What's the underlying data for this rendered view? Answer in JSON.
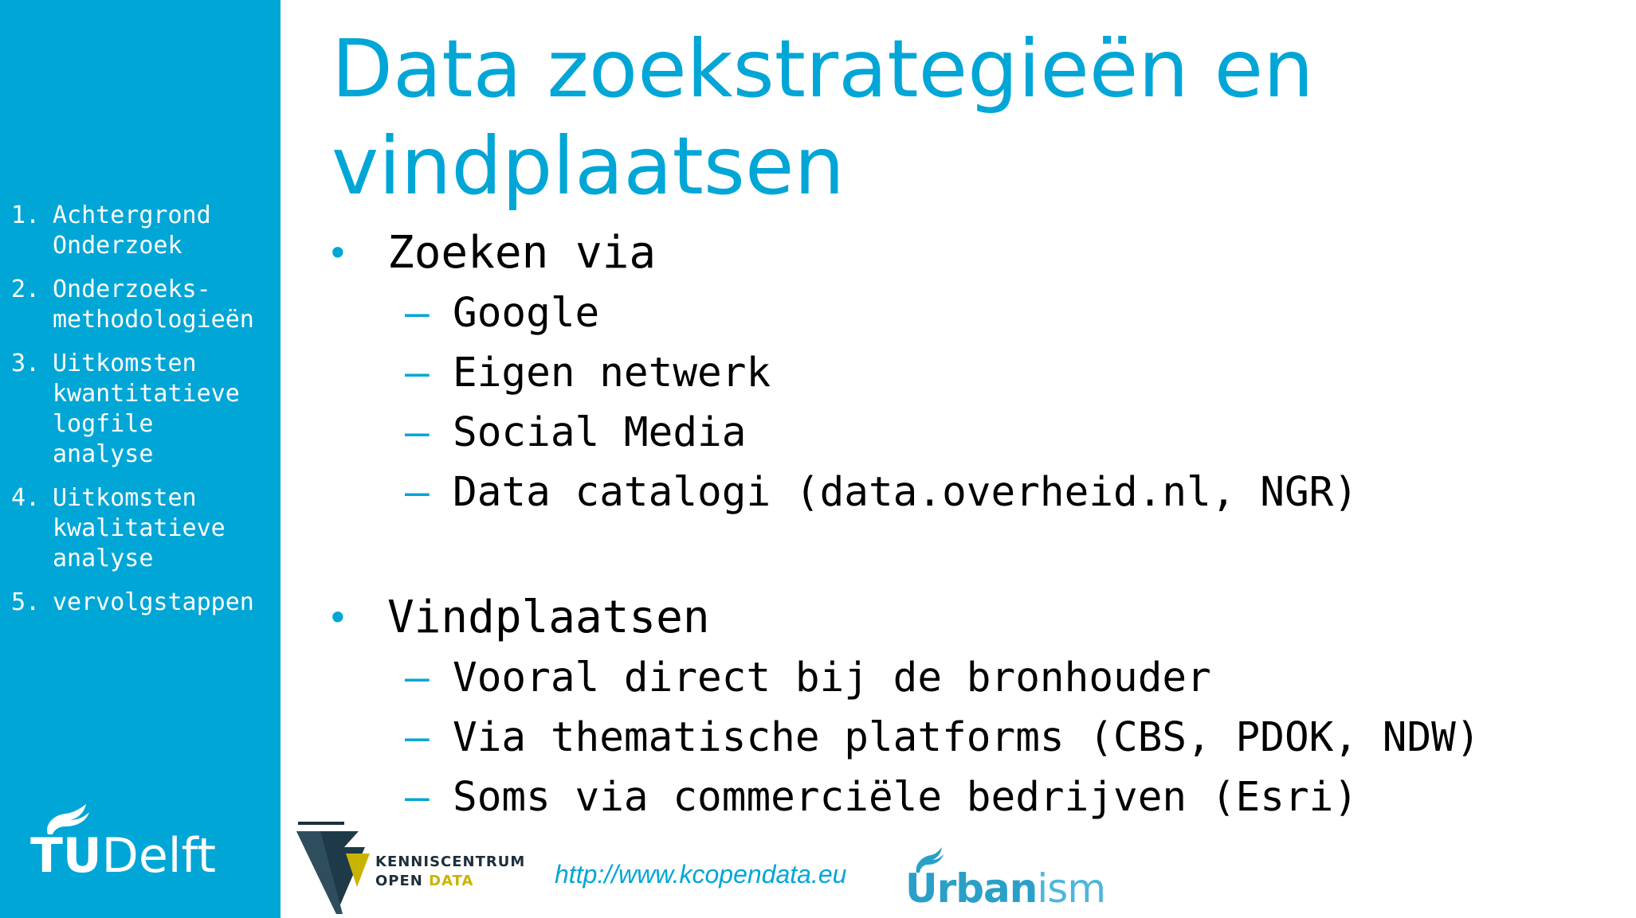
{
  "sidebar": {
    "background": "#00a6d6",
    "toc": [
      {
        "num": "1.",
        "label": "Achtergrond\nOnderzoek"
      },
      {
        "num": "2.",
        "label": "Onderzoeks-\nmethodologieën"
      },
      {
        "num": "3.",
        "label": "Uitkomsten\nkwantitatieve\nlogfile\nanalyse"
      },
      {
        "num": "4.",
        "label": "Uitkomsten\nkwalitatieve\nanalyse"
      },
      {
        "num": "5.",
        "label": "vervolgstappen"
      }
    ],
    "logo": {
      "tu": "TU",
      "delft": "Delft",
      "icon": "flame-icon"
    }
  },
  "slide": {
    "title_line1": "Data zoekstrategieën en",
    "title_line2": "vindplaatsen",
    "accent_color": "#00a6d6",
    "sections": [
      {
        "bullet": "•",
        "heading": "Zoeken via",
        "items": [
          {
            "dash": "–",
            "text": "Google"
          },
          {
            "dash": "–",
            "text": "Eigen netwerk"
          },
          {
            "dash": "–",
            "text": "Social Media"
          },
          {
            "dash": "–",
            "text": "Data catalogi (data.overheid.nl, NGR)"
          }
        ]
      },
      {
        "bullet": "•",
        "heading": "Vindplaatsen",
        "items": [
          {
            "dash": "–",
            "text": "Vooral direct bij de bronhouder"
          },
          {
            "dash": "–",
            "text": "Via thematische platforms (CBS, PDOK, NDW)"
          },
          {
            "dash": "–",
            "text": "Soms via commerciële bedrijven (Esri)"
          }
        ]
      }
    ]
  },
  "footer": {
    "kc_line1": "KENNISCENTRUM",
    "kc_open": "OPEN ",
    "kc_data": "DATA",
    "url": "http://www.kcopendata.eu",
    "urbanism_bold": "Urban",
    "urbanism_light": "ism"
  }
}
